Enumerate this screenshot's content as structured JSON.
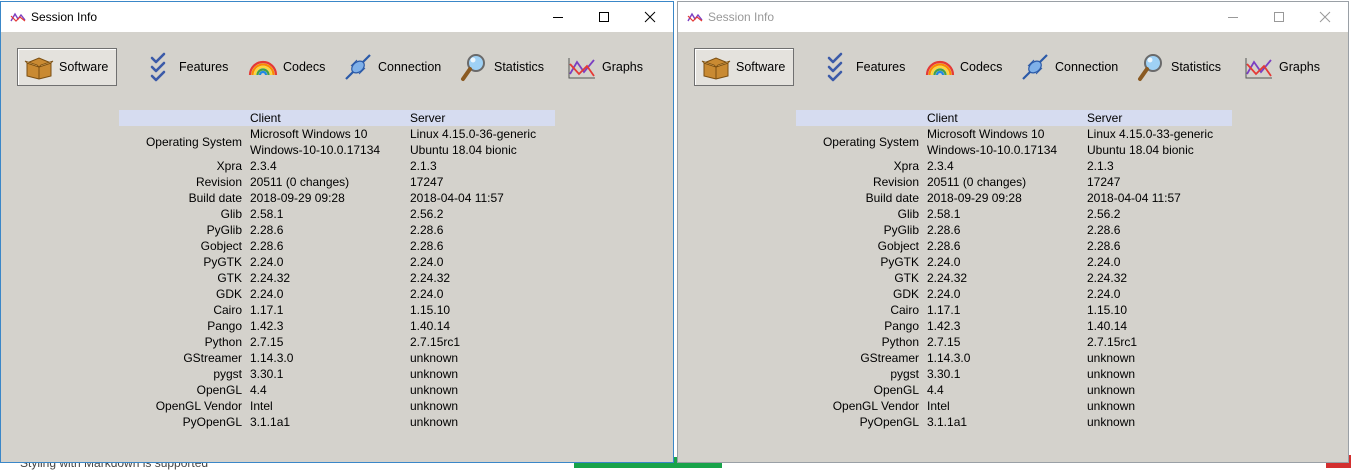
{
  "background": {
    "partial_text": "Styling with Markdown is supported"
  },
  "tabs": [
    {
      "label": "Software",
      "icon": "box-icon"
    },
    {
      "label": "Features",
      "icon": "checklist-icon"
    },
    {
      "label": "Codecs",
      "icon": "rainbow-icon"
    },
    {
      "label": "Connection",
      "icon": "plug-icon"
    },
    {
      "label": "Statistics",
      "icon": "magnifier-icon"
    },
    {
      "label": "Graphs",
      "icon": "graph-icon"
    }
  ],
  "windows": [
    {
      "title": "Session Info",
      "header": {
        "client": "Client",
        "server": "Server"
      },
      "os": {
        "label": "Operating System",
        "client_line1": "Microsoft Windows 10",
        "client_line2": "Windows-10-10.0.17134",
        "server_line1": "Linux 4.15.0-36-generic",
        "server_line2": "Ubuntu 18.04 bionic"
      },
      "rows": [
        {
          "label": "Xpra",
          "client": "2.3.4",
          "server": "2.1.3"
        },
        {
          "label": "Revision",
          "client": "20511 (0 changes)",
          "server": "17247"
        },
        {
          "label": "Build date",
          "client": "2018-09-29 09:28",
          "server": "2018-04-04 11:57"
        },
        {
          "label": "Glib",
          "client": "2.58.1",
          "server": "2.56.2"
        },
        {
          "label": "PyGlib",
          "client": "2.28.6",
          "server": "2.28.6"
        },
        {
          "label": "Gobject",
          "client": "2.28.6",
          "server": "2.28.6"
        },
        {
          "label": "PyGTK",
          "client": "2.24.0",
          "server": "2.24.0"
        },
        {
          "label": "GTK",
          "client": "2.24.32",
          "server": "2.24.32"
        },
        {
          "label": "GDK",
          "client": "2.24.0",
          "server": "2.24.0"
        },
        {
          "label": "Cairo",
          "client": "1.17.1",
          "server": "1.15.10"
        },
        {
          "label": "Pango",
          "client": "1.42.3",
          "server": "1.40.14"
        },
        {
          "label": "Python",
          "client": "2.7.15",
          "server": "2.7.15rc1"
        },
        {
          "label": "GStreamer",
          "client": "1.14.3.0",
          "server": "unknown"
        },
        {
          "label": "pygst",
          "client": "3.30.1",
          "server": "unknown"
        },
        {
          "label": "OpenGL",
          "client": "4.4",
          "server": "unknown"
        },
        {
          "label": "OpenGL Vendor",
          "client": "Intel",
          "server": "unknown"
        },
        {
          "label": "PyOpenGL",
          "client": "3.1.1a1",
          "server": "unknown"
        }
      ]
    },
    {
      "title": "Session Info",
      "header": {
        "client": "Client",
        "server": "Server"
      },
      "os": {
        "label": "Operating System",
        "client_line1": "Microsoft Windows 10",
        "client_line2": "Windows-10-10.0.17134",
        "server_line1": "Linux 4.15.0-33-generic",
        "server_line2": "Ubuntu 18.04 bionic"
      },
      "rows": [
        {
          "label": "Xpra",
          "client": "2.3.4",
          "server": "2.1.3"
        },
        {
          "label": "Revision",
          "client": "20511 (0 changes)",
          "server": "17247"
        },
        {
          "label": "Build date",
          "client": "2018-09-29 09:28",
          "server": "2018-04-04 11:57"
        },
        {
          "label": "Glib",
          "client": "2.58.1",
          "server": "2.56.2"
        },
        {
          "label": "PyGlib",
          "client": "2.28.6",
          "server": "2.28.6"
        },
        {
          "label": "Gobject",
          "client": "2.28.6",
          "server": "2.28.6"
        },
        {
          "label": "PyGTK",
          "client": "2.24.0",
          "server": "2.24.0"
        },
        {
          "label": "GTK",
          "client": "2.24.32",
          "server": "2.24.32"
        },
        {
          "label": "GDK",
          "client": "2.24.0",
          "server": "2.24.0"
        },
        {
          "label": "Cairo",
          "client": "1.17.1",
          "server": "1.15.10"
        },
        {
          "label": "Pango",
          "client": "1.42.3",
          "server": "1.40.14"
        },
        {
          "label": "Python",
          "client": "2.7.15",
          "server": "2.7.15rc1"
        },
        {
          "label": "GStreamer",
          "client": "1.14.3.0",
          "server": "unknown"
        },
        {
          "label": "pygst",
          "client": "3.30.1",
          "server": "unknown"
        },
        {
          "label": "OpenGL",
          "client": "4.4",
          "server": "unknown"
        },
        {
          "label": "OpenGL Vendor",
          "client": "Intel",
          "server": "unknown"
        },
        {
          "label": "PyOpenGL",
          "client": "3.1.1a1",
          "server": "unknown"
        }
      ]
    }
  ]
}
